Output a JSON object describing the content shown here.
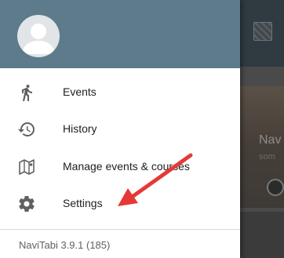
{
  "app": {
    "version_text": "NaviTabi 3.9.1 (185)"
  },
  "drawer": {
    "header_color": "#5d7b8b",
    "menu": [
      {
        "label": "Events",
        "icon": "walking-person-icon"
      },
      {
        "label": "History",
        "icon": "history-clock-icon"
      },
      {
        "label": "Manage events & courses",
        "icon": "folded-map-icon"
      },
      {
        "label": "Settings",
        "icon": "gear-icon"
      }
    ]
  },
  "background": {
    "card_title": "Nav",
    "card_subtitle": "som"
  },
  "colors": {
    "annotation_arrow": "#e53935",
    "icon": "#616161",
    "text": "#212121"
  }
}
